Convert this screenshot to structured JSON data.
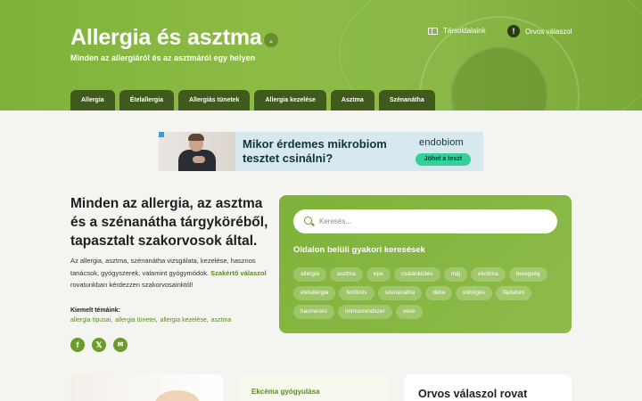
{
  "header": {
    "title": "Allergia és asztma",
    "tagline": "Minden az allergiáról és az asztmáról egy helyen",
    "links": {
      "partners": "Társoldalaink",
      "doctor": "Orvos válaszol"
    }
  },
  "tabs": [
    "Allergia",
    "Ételallergia",
    "Allergiás tünetek",
    "Allergia kezelése",
    "Asztma",
    "Szénanátha"
  ],
  "ad": {
    "headline": "Mikor érdemes mikrobiom tesztet csinálni?",
    "brand": "endobiom",
    "cta": "Jöhet a teszt"
  },
  "intro": {
    "title": "Minden az allergia, az asztma és a szénanátha tárgyköréből, tapasztalt szakorvosok által.",
    "text_before": "Az allergia, asztma, szénanátha vizsgálata, kezelése, hasznos tanácsok, gyógyszerek, valamint gyógymódok. ",
    "link": "Szakértő válaszol",
    "text_after": " rovatunkban kérdezzen szakorvosainktól!",
    "featured_label": "Kiemelt témáink:",
    "featured": [
      "allergia típusai",
      "allergia tünetei",
      "allergia kezelése",
      "asztma"
    ]
  },
  "social": {
    "facebook": "f",
    "x": "𝕏",
    "email": "✉"
  },
  "search": {
    "placeholder": "Keresés...",
    "faq_title": "Oldalon belüli gyakori keresések",
    "chips": [
      "allergia",
      "asztma",
      "epe",
      "csalánkiütés",
      "máj",
      "ekcéma",
      "betegség",
      "ételallergia",
      "fertőzés",
      "szénanátha",
      "diéta",
      "köhögés",
      "fájdalom",
      "hasmenés",
      "immunrendszer",
      "vese"
    ]
  },
  "cards": {
    "middle_label": "Ekcéma gyógyulása",
    "right_title": "Orvos válaszol rovat"
  },
  "colors": {
    "brand_green": "#7fb23a",
    "tab_dark": "#3f5a1c",
    "link_green": "#5d8a20",
    "cta": "#33d19a"
  }
}
